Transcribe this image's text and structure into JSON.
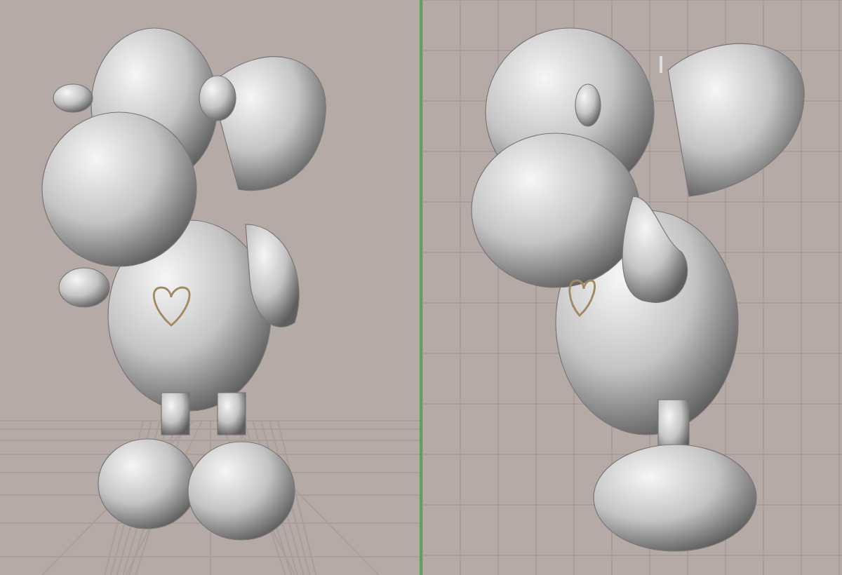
{
  "viewports": [
    {
      "kind": "perspective"
    },
    {
      "kind": "front"
    }
  ]
}
